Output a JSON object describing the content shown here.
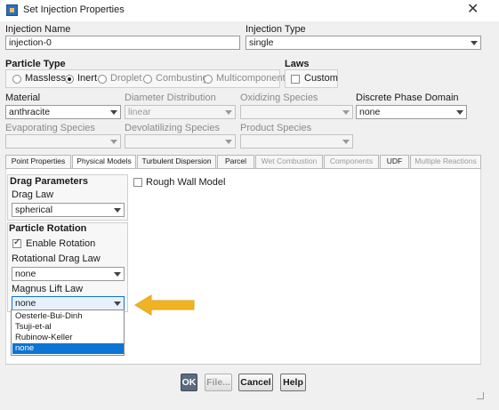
{
  "window": {
    "title": "Set Injection Properties",
    "close_glyph": "✕"
  },
  "injection_name": {
    "label": "Injection Name",
    "value": "injection-0"
  },
  "injection_type": {
    "label": "Injection Type",
    "value": "single"
  },
  "particle_type": {
    "label": "Particle Type",
    "options": [
      "Massless",
      "Inert",
      "Droplet",
      "Combusting",
      "Multicomponent"
    ],
    "selected": "Inert"
  },
  "laws": {
    "label": "Laws",
    "custom_label": "Custom",
    "custom_checked": false
  },
  "material": {
    "label": "Material",
    "value": "anthracite"
  },
  "diameter_distribution": {
    "label": "Diameter Distribution",
    "value": "linear"
  },
  "oxidizing_species": {
    "label": "Oxidizing Species",
    "value": ""
  },
  "discrete_phase_domain": {
    "label": "Discrete Phase Domain",
    "value": "none"
  },
  "evaporating_species": {
    "label": "Evaporating Species",
    "value": ""
  },
  "devolatilizing_species": {
    "label": "Devolatilizing Species",
    "value": ""
  },
  "product_species": {
    "label": "Product Species",
    "value": ""
  },
  "tabs": [
    {
      "label": "Point Properties",
      "active": false,
      "enabled": true
    },
    {
      "label": "Physical Models",
      "active": true,
      "enabled": true
    },
    {
      "label": "Turbulent Dispersion",
      "active": false,
      "enabled": true
    },
    {
      "label": "Parcel",
      "active": false,
      "enabled": true
    },
    {
      "label": "Wet Combustion",
      "active": false,
      "enabled": false
    },
    {
      "label": "Components",
      "active": false,
      "enabled": false
    },
    {
      "label": "UDF",
      "active": false,
      "enabled": true
    },
    {
      "label": "Multiple Reactions",
      "active": false,
      "enabled": false
    }
  ],
  "drag": {
    "heading": "Drag Parameters",
    "law_label": "Drag Law",
    "law_value": "spherical"
  },
  "rough_wall": {
    "label": "Rough Wall Model",
    "checked": false
  },
  "rotation": {
    "heading": "Particle Rotation",
    "enable_label": "Enable Rotation",
    "enable_checked": true,
    "drag_law_label": "Rotational Drag Law",
    "drag_law_value": "none",
    "magnus_label": "Magnus Lift Law",
    "magnus_value": "none",
    "magnus_options": [
      "Oesterle-Bui-Dinh",
      "Tsuji-et-al",
      "Rubinow-Keller",
      "none"
    ],
    "magnus_highlighted": "none"
  },
  "buttons": {
    "ok": "OK",
    "file": "File...",
    "cancel": "Cancel",
    "help": "Help"
  },
  "colors": {
    "accent_blue": "#0b74d4",
    "arrow_yellow": "#f0b323",
    "ok_button": "#5b6b7d"
  }
}
